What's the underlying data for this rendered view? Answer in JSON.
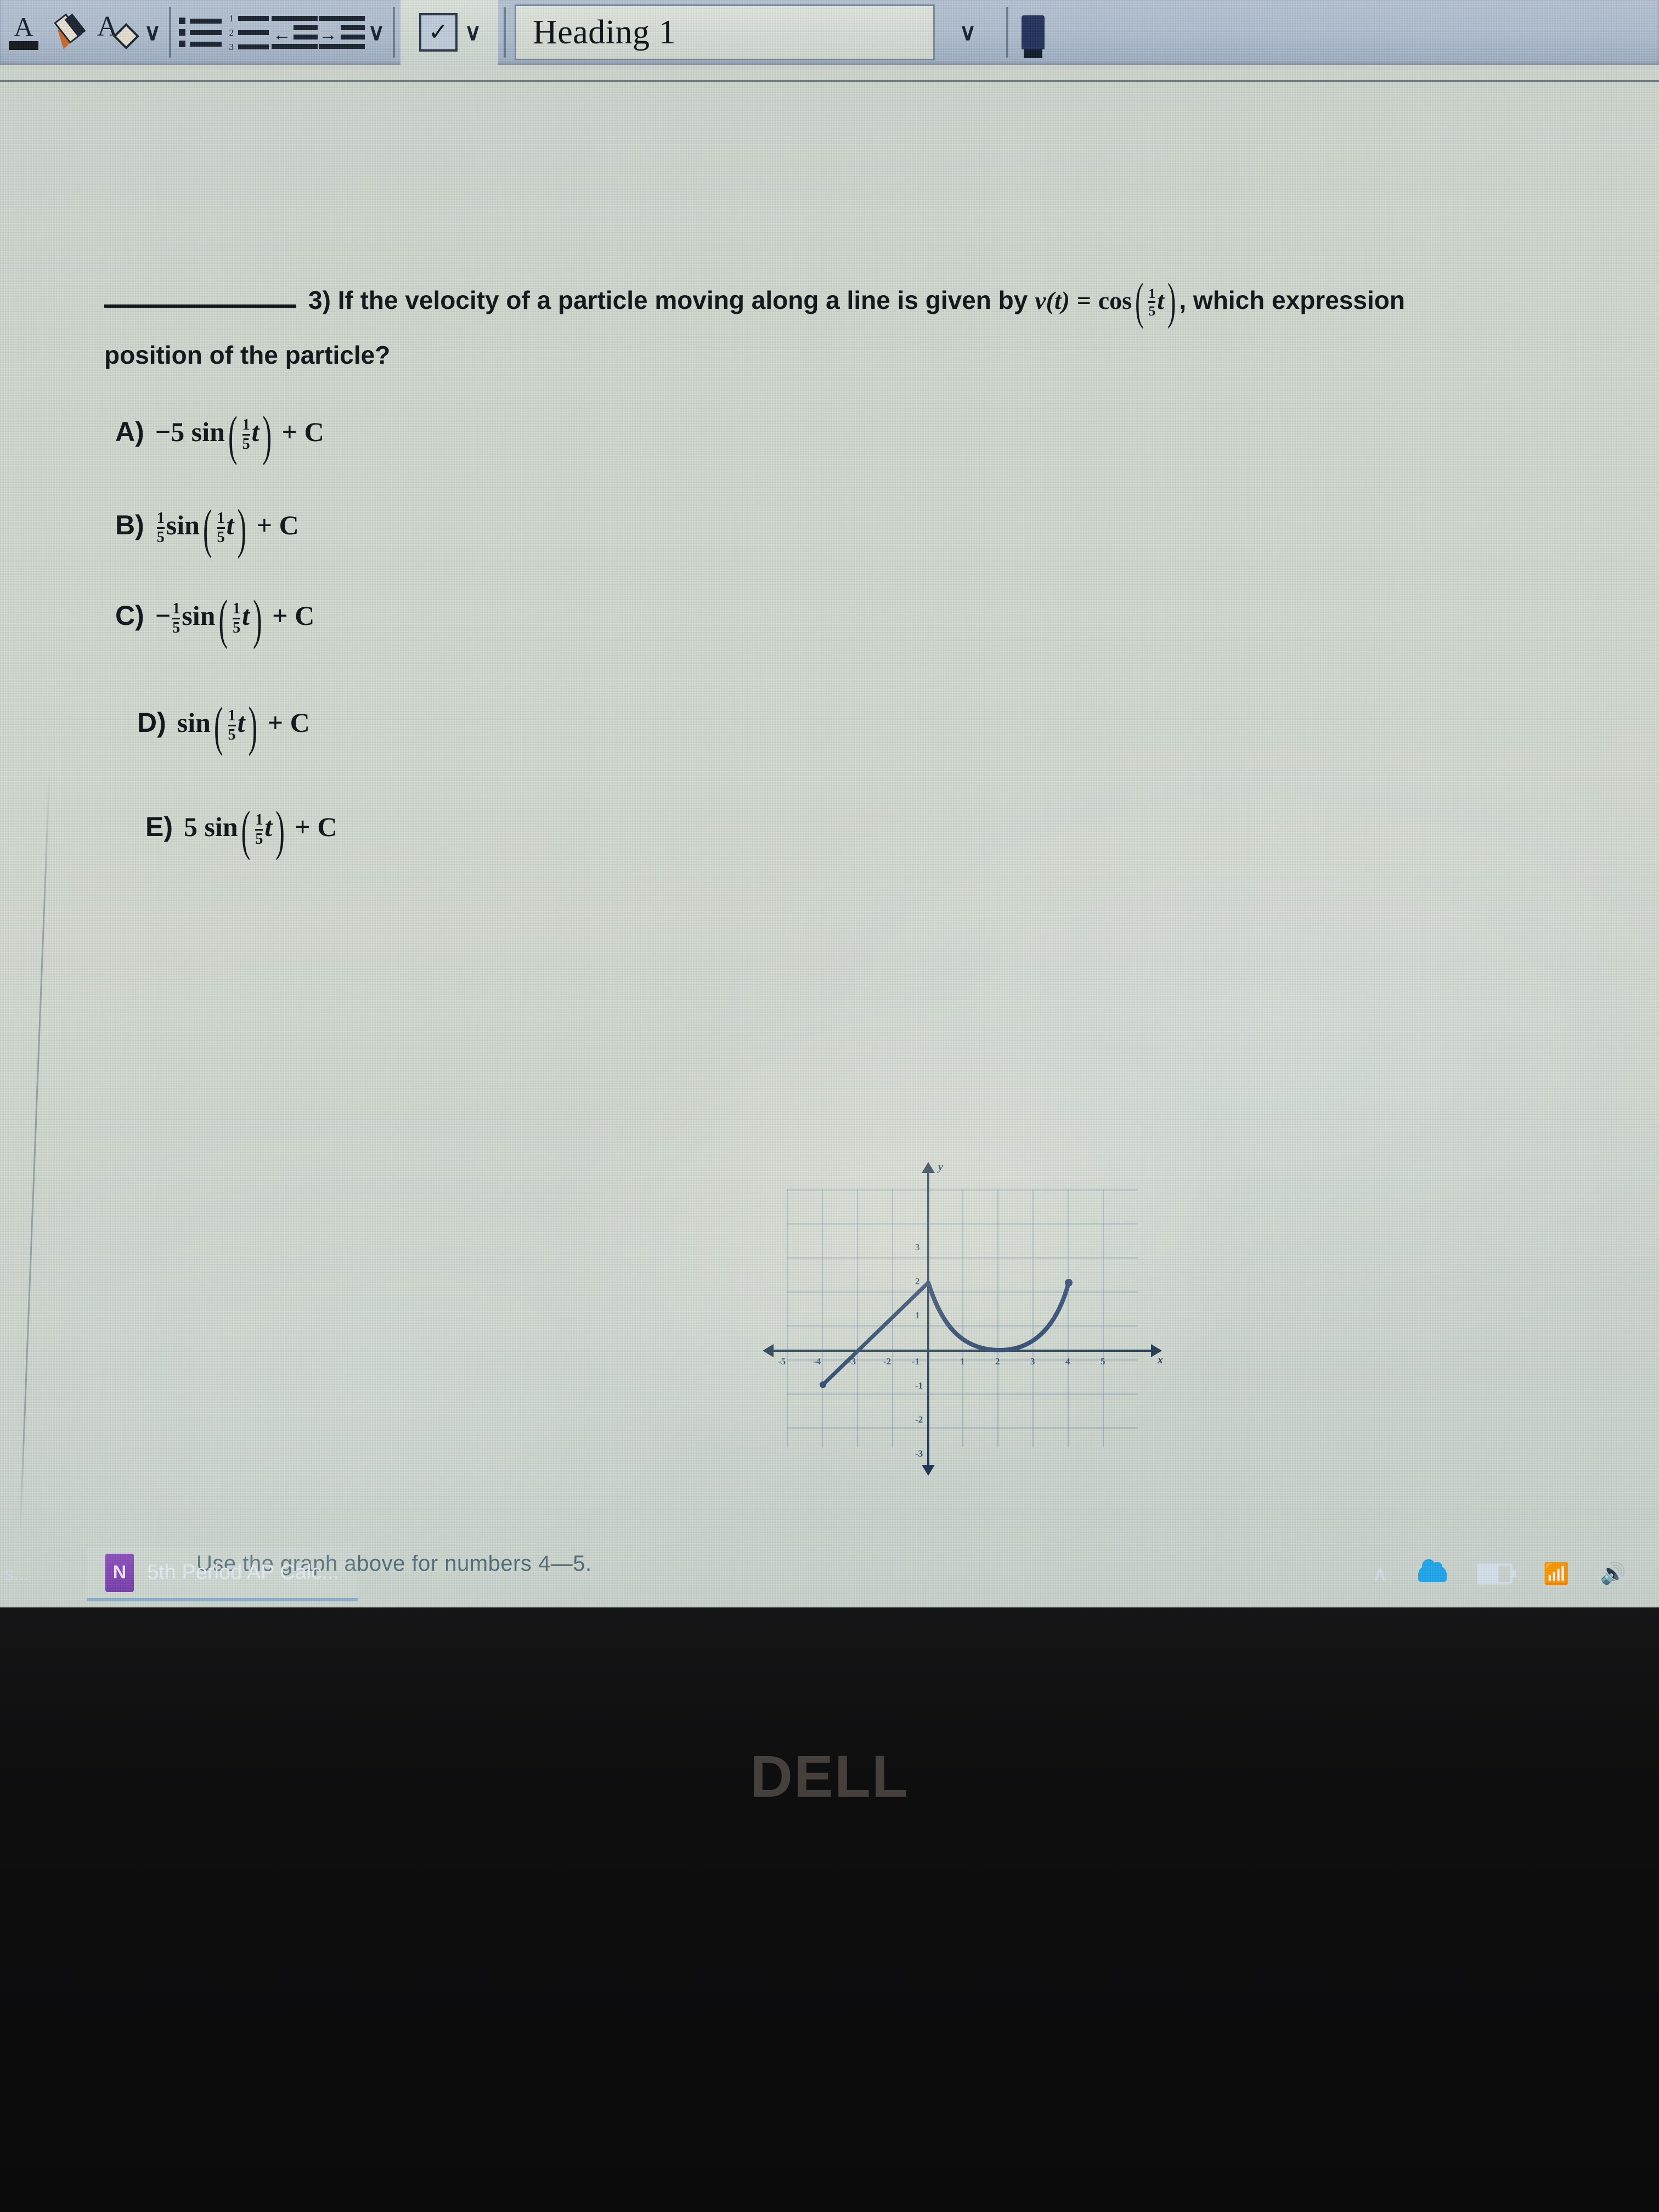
{
  "app": {
    "name": "Microsoft Word",
    "ribbon": {
      "font_color_icon": "font-color-icon",
      "font_color_letter": "A",
      "highlight_icon": "text-highlight-marker-icon",
      "clear_formatting_icon": "clear-formatting-icon",
      "clear_formatting_letter": "A",
      "font_dropdown_caret": "∨",
      "bullets_icon": "bulleted-list-icon",
      "numbering_icon": "numbered-list-icon",
      "numbering_digits": [
        "1",
        "2",
        "3"
      ],
      "decrease_indent_icon": "decrease-indent-icon",
      "decrease_indent_glyph": "←",
      "increase_indent_icon": "increase-indent-icon",
      "increase_indent_glyph": "→",
      "paragraph_dropdown_caret": "∨",
      "checkbox_glyph": "✓",
      "checkbox_dropdown_caret": "∨",
      "style_name": "Heading 1",
      "styles_dropdown_caret": "∨",
      "pen_icon": "ink-pen-icon"
    }
  },
  "document": {
    "question": {
      "blank": "",
      "number": "3)",
      "text_before_formula": "If the velocity of a particle moving along a line is given by",
      "formula": {
        "function": "v(t)",
        "equals": "=",
        "operator": "cos",
        "argument_num": "1",
        "argument_den": "5",
        "argument_var": "t"
      },
      "text_after_formula": ", which expression",
      "line2": "position of the particle?"
    },
    "choices": [
      {
        "label": "A)",
        "coefficient": "−5",
        "coefficient_is_fraction": false,
        "operator": "sin",
        "arg_num": "1",
        "arg_den": "5",
        "arg_var": "t",
        "tail": "+ C",
        "text": "A)  −5 sin(1/5 t) + C"
      },
      {
        "label": "B)",
        "coefficient": "1/5",
        "coefficient_is_fraction": true,
        "coef_num": "1",
        "coef_den": "5",
        "operator": "sin",
        "arg_num": "1",
        "arg_den": "5",
        "arg_var": "t",
        "tail": "+ C",
        "text": "B)  1/5 sin(1/5 t) + C"
      },
      {
        "label": "C)",
        "coefficient": "−1/5",
        "coefficient_is_fraction": true,
        "coef_sign": "−",
        "coef_num": "1",
        "coef_den": "5",
        "operator": "sin",
        "arg_num": "1",
        "arg_den": "5",
        "arg_var": "t",
        "tail": "+ C",
        "text": "C)  − 1/5 sin(1/5 t) + C"
      },
      {
        "label": "D)",
        "coefficient": "",
        "coefficient_is_fraction": false,
        "operator": "sin",
        "arg_num": "1",
        "arg_den": "5",
        "arg_var": "t",
        "tail": "+ C",
        "text": "D)  sin(1/5 t) + C"
      },
      {
        "label": "E)",
        "coefficient": "5",
        "coefficient_is_fraction": false,
        "operator": "sin",
        "arg_num": "1",
        "arg_den": "5",
        "arg_var": "t",
        "tail": "+ C",
        "text": "E)  5 sin(1/5 t) + C"
      }
    ],
    "caption": "Use the graph above for numbers 4—5."
  },
  "chart_data": {
    "type": "line",
    "title": "",
    "xlabel": "x",
    "ylabel": "y",
    "xlim": [
      -5.5,
      5.5
    ],
    "ylim": [
      -4,
      4
    ],
    "grid": true,
    "legend": false,
    "x_ticks": [
      -5,
      -4,
      -3,
      -2,
      -1,
      1,
      2,
      3,
      4,
      5
    ],
    "y_ticks": [
      -3,
      -2,
      -1,
      1,
      2,
      3
    ],
    "series": [
      {
        "name": "line-segment",
        "type": "line",
        "points": [
          [
            -3,
            -1
          ],
          [
            0,
            2
          ]
        ],
        "endpoint_open_left": true
      },
      {
        "name": "semicircle-arc",
        "type": "curve",
        "points": [
          [
            0,
            2
          ],
          [
            0.4,
            1.2
          ],
          [
            0.9,
            0.6
          ],
          [
            1.5,
            0.2
          ],
          [
            2,
            0.05
          ],
          [
            2.5,
            0.05
          ],
          [
            3,
            0.25
          ],
          [
            3.5,
            0.75
          ],
          [
            3.85,
            1.45
          ],
          [
            4,
            2
          ]
        ],
        "endpoint_dot_right": true
      }
    ]
  },
  "taskbar": {
    "left_overflow": "s...",
    "item": {
      "icon": "onenote-icon",
      "icon_letter": "N",
      "label": "5th Period AP Calc..."
    },
    "tray": {
      "show_hidden_icons": "∧",
      "onedrive": "onedrive-cloud-icon",
      "battery": "battery-icon",
      "network": "wifi-icon",
      "network_glyph": "📶",
      "volume": "volume-icon",
      "volume_glyph": "🔊"
    }
  },
  "hardware": {
    "brand": "DELL"
  },
  "colors": {
    "ribbon": "#b2c1d2",
    "taskbar": "#365880",
    "screen_paper": "#d3dbd2",
    "ink": "#0f1418",
    "graph_blue": "#17324f",
    "grid_blue": "#466ea0",
    "caption": "#4e6b77",
    "onenote_purple": "#8e4fc0",
    "bezel": "#0e0e0f"
  }
}
